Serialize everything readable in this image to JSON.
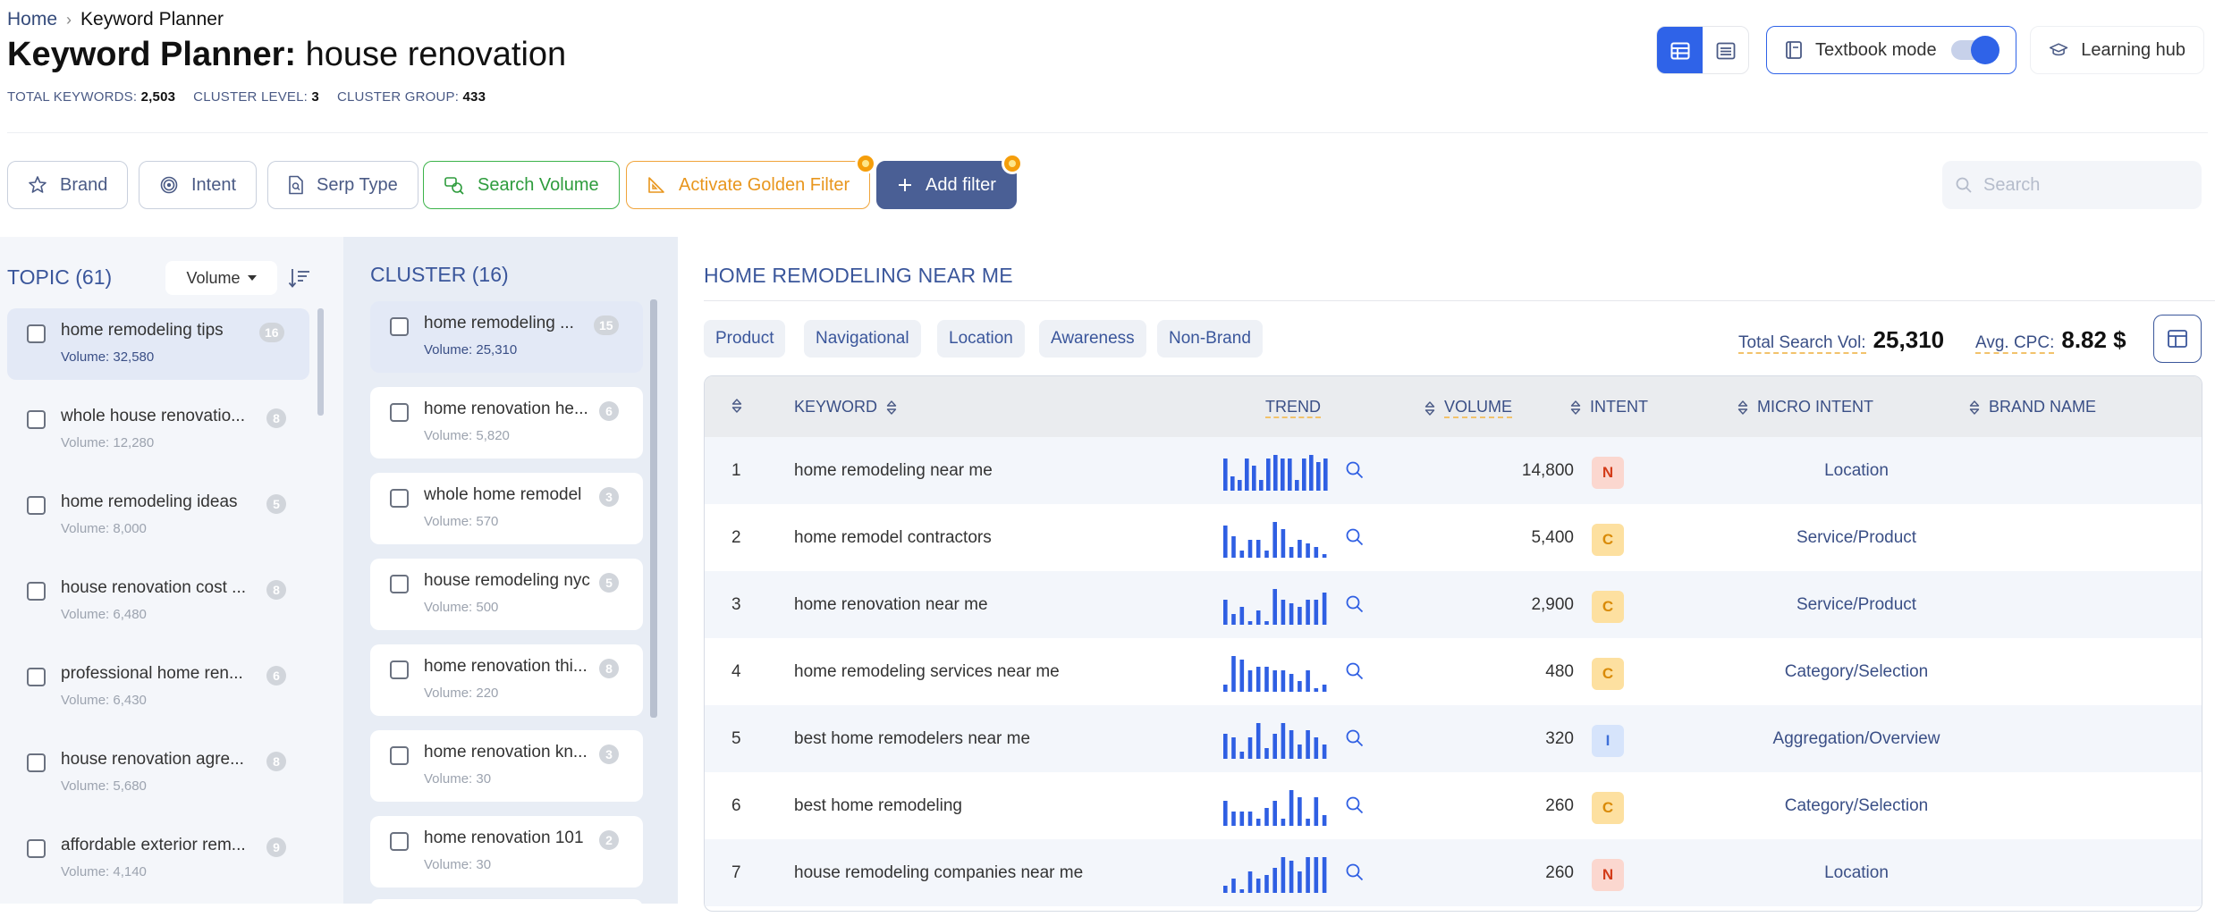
{
  "breadcrumb": {
    "home": "Home",
    "current": "Keyword Planner"
  },
  "title": {
    "prefix": "Keyword Planner:",
    "query": "house renovation"
  },
  "stats": {
    "total_keywords_label": "TOTAL KEYWORDS:",
    "total_keywords": "2,503",
    "cluster_level_label": "CLUSTER LEVEL:",
    "cluster_level": "3",
    "cluster_group_label": "CLUSTER GROUP:",
    "cluster_group": "433"
  },
  "toolbar": {
    "textbook_mode": "Textbook mode",
    "textbook_on": true,
    "learning_hub": "Learning hub"
  },
  "filters": {
    "brand": "Brand",
    "intent": "Intent",
    "serp_type": "Serp Type",
    "search_volume": "Search Volume",
    "golden_filter": "Activate Golden Filter",
    "add_filter": "Add filter",
    "search_placeholder": "Search"
  },
  "topics": {
    "heading": "TOPIC (61)",
    "sort_select": "Volume",
    "items": [
      {
        "title": "home remodeling tips",
        "volume": "Volume: 32,580",
        "count": "16"
      },
      {
        "title": "whole house renovatio...",
        "volume": "Volume: 12,280",
        "count": "8"
      },
      {
        "title": "home remodeling ideas",
        "volume": "Volume: 8,000",
        "count": "5"
      },
      {
        "title": "house renovation cost ...",
        "volume": "Volume: 6,480",
        "count": "8"
      },
      {
        "title": "professional home ren...",
        "volume": "Volume: 6,430",
        "count": "6"
      },
      {
        "title": "house renovation agre...",
        "volume": "Volume: 5,680",
        "count": "8"
      },
      {
        "title": "affordable exterior rem...",
        "volume": "Volume: 4,140",
        "count": "9"
      }
    ]
  },
  "clusters": {
    "heading": "CLUSTER (16)",
    "items": [
      {
        "title": "home remodeling ...",
        "volume": "Volume: 25,310",
        "count": "15"
      },
      {
        "title": "home renovation he...",
        "volume": "Volume: 5,820",
        "count": "6"
      },
      {
        "title": "whole home remodel",
        "volume": "Volume: 570",
        "count": "3"
      },
      {
        "title": "house remodeling nyc",
        "volume": "Volume: 500",
        "count": "5"
      },
      {
        "title": "home renovation thi...",
        "volume": "Volume: 220",
        "count": "8"
      },
      {
        "title": "home renovation kn...",
        "volume": "Volume: 30",
        "count": "3"
      },
      {
        "title": "home renovation 101",
        "volume": "Volume: 30",
        "count": "2"
      }
    ]
  },
  "main": {
    "title": "HOME REMODELING NEAR ME",
    "chips": [
      "Product",
      "Navigational",
      "Location",
      "Awareness",
      "Non-Brand"
    ],
    "total_search_vol_label": "Total Search Vol:",
    "total_search_vol": "25,310",
    "avg_cpc_label": "Avg. CPC:",
    "avg_cpc": "8.82 $"
  },
  "table": {
    "headers": {
      "keyword": "KEYWORD",
      "trend": "TREND",
      "volume": "VOLUME",
      "intent": "INTENT",
      "micro_intent": "MICRO INTENT",
      "brand_name": "BRAND NAME"
    },
    "rows": [
      {
        "num": "1",
        "keyword": "home remodeling near me",
        "volume": "14,800",
        "intent": "N",
        "micro": "Location",
        "trend": [
          9,
          4,
          3,
          9,
          7,
          3,
          9,
          10,
          9,
          9,
          3,
          9,
          10,
          8,
          9
        ]
      },
      {
        "num": "2",
        "keyword": "home remodel contractors",
        "volume": "5,400",
        "intent": "C",
        "micro": "Service/Product",
        "trend": [
          9,
          6,
          2,
          5,
          5,
          2,
          10,
          8,
          3,
          5,
          4,
          3,
          1
        ]
      },
      {
        "num": "3",
        "keyword": "home renovation near me",
        "volume": "2,900",
        "intent": "C",
        "micro": "Service/Product",
        "trend": [
          7,
          3,
          5,
          1,
          4,
          1,
          10,
          7,
          6,
          5,
          7,
          7,
          9
        ]
      },
      {
        "num": "4",
        "keyword": "home remodeling services near me",
        "volume": "480",
        "intent": "C",
        "micro": "Category/Selection",
        "trend": [
          2,
          10,
          9,
          6,
          7,
          7,
          6,
          6,
          5,
          3,
          6,
          1,
          2
        ]
      },
      {
        "num": "5",
        "keyword": "best home remodelers near me",
        "volume": "320",
        "intent": "I",
        "micro": "Aggregation/Overview",
        "trend": [
          7,
          6,
          2,
          6,
          10,
          3,
          7,
          10,
          8,
          4,
          8,
          6,
          4
        ]
      },
      {
        "num": "6",
        "keyword": "best home remodeling",
        "volume": "260",
        "intent": "C",
        "micro": "Category/Selection",
        "trend": [
          7,
          4,
          4,
          4,
          2,
          5,
          7,
          2,
          10,
          8,
          2,
          8,
          3
        ]
      },
      {
        "num": "7",
        "keyword": "house remodeling companies near me",
        "volume": "260",
        "intent": "N",
        "micro": "Location",
        "trend": [
          2,
          4,
          1,
          6,
          4,
          5,
          7,
          10,
          9,
          6,
          10,
          10,
          10
        ]
      }
    ]
  },
  "colors": {
    "accent": "#2f63e8",
    "nav": "#3a569b",
    "trend_bar": "#2f5fe3",
    "green": "#2e9c3d",
    "gold": "#e8961d"
  }
}
